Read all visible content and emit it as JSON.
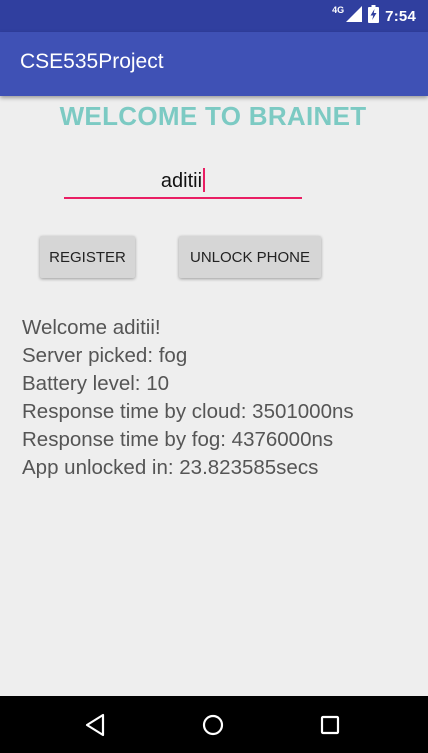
{
  "status_bar": {
    "network_label": "4G",
    "time": "7:54",
    "icons": [
      "signal-icon",
      "battery-charging-icon"
    ]
  },
  "app_bar": {
    "title": "CSE535Project"
  },
  "main": {
    "heading": "WELCOME TO BRAINET",
    "name_input": {
      "value": "aditii"
    },
    "buttons": {
      "register": "REGISTER",
      "unlock": "UNLOCK PHONE"
    },
    "results": [
      "Welcome aditii!",
      "Server picked: fog",
      "Battery level: 10",
      "Response time by cloud: 3501000ns",
      "Response time by fog: 4376000ns",
      "App unlocked in: 23.823585secs"
    ]
  },
  "nav_bar": {
    "icons": [
      "back-icon",
      "home-icon",
      "recents-icon"
    ]
  },
  "colors": {
    "status_bar": "#303f9f",
    "app_bar": "#3f51b5",
    "heading": "#7ccac3",
    "accent": "#e91e63",
    "button": "#d6d6d6",
    "background": "#eeeeee"
  }
}
